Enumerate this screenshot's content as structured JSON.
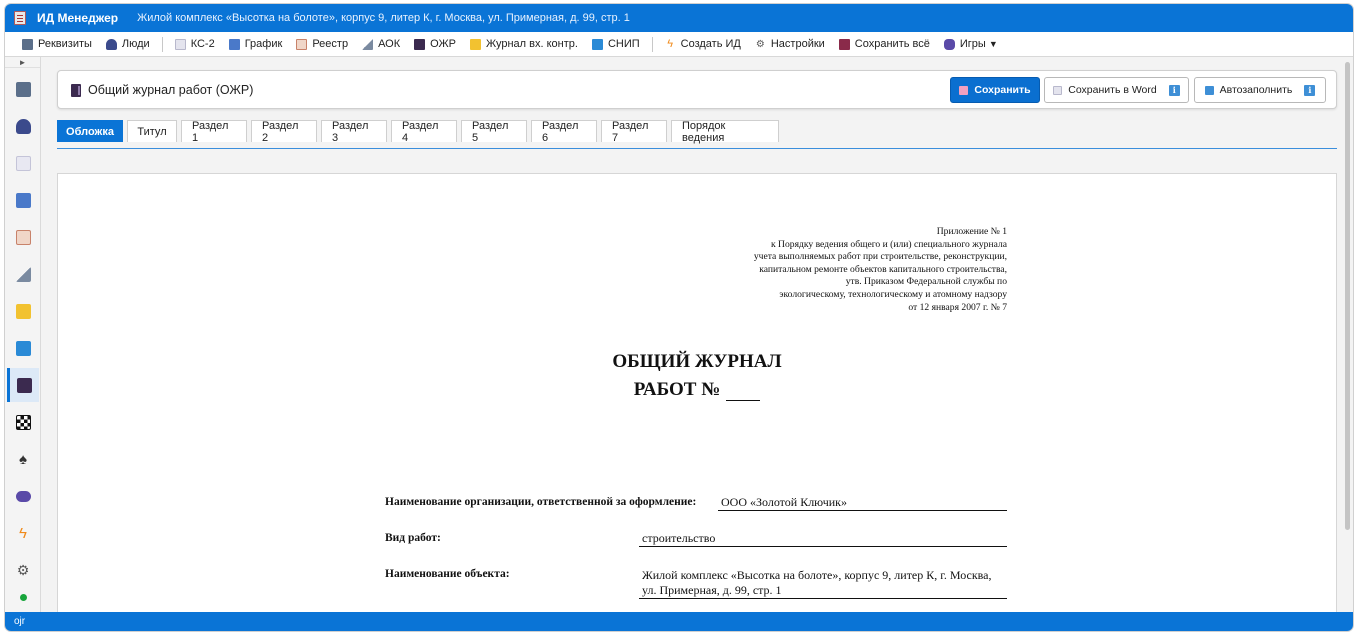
{
  "window": {
    "app_name": "ИД Менеджер",
    "project": "Жилой комплекс «Высотка на болоте», корпус 9, литер К, г. Москва, ул. Примерная, д. 99, стр. 1"
  },
  "toolbar": {
    "items": [
      {
        "label": "Реквизиты",
        "icon": "building-icon",
        "color": "#5b6f8a"
      },
      {
        "label": "Люди",
        "icon": "people-icon",
        "color": "#3b4a8c"
      },
      {
        "label": "КС-2",
        "icon": "document-icon",
        "color": "#c8c8dc"
      },
      {
        "label": "График",
        "icon": "calendar-icon",
        "color": "#4a79c9"
      },
      {
        "label": "Реестр",
        "icon": "clipboard-icon",
        "color": "#d99a7a"
      },
      {
        "label": "АОК",
        "icon": "ruler-triangle-icon",
        "color": "#7a8aa0"
      },
      {
        "label": "ОЖР",
        "icon": "book-icon",
        "color": "#3b2a4f"
      },
      {
        "label": "Журнал вх. контр.",
        "icon": "notepad-icon",
        "color": "#f2c230"
      },
      {
        "label": "СНИП",
        "icon": "blue-book-icon",
        "color": "#2a8ad6"
      },
      {
        "label": "Создать ИД",
        "icon": "lightning-icon",
        "color": "#f08a1a"
      },
      {
        "label": "Настройки",
        "icon": "gear-icon",
        "color": "#666666"
      },
      {
        "label": "Сохранить всё",
        "icon": "floppy-icon",
        "color": "#8a2a4a"
      },
      {
        "label": "Игры",
        "icon": "gamepad-icon",
        "color": "#5a4aa8",
        "caret": "▼"
      }
    ]
  },
  "sidebar": {
    "toggle": "►",
    "items": [
      {
        "icon": "building-icon",
        "color": "#5b6f8a"
      },
      {
        "icon": "people-icon",
        "color": "#3b4a8c"
      },
      {
        "icon": "document-icon",
        "color": "#d6d6e6"
      },
      {
        "icon": "calendar-icon",
        "color": "#4a79c9"
      },
      {
        "icon": "clipboard-icon",
        "color": "#d99a7a"
      },
      {
        "icon": "ruler-triangle-icon",
        "color": "#7a8aa0"
      },
      {
        "icon": "notepad-icon",
        "color": "#f2c230"
      },
      {
        "icon": "blue-book-icon",
        "color": "#2a8ad6"
      },
      {
        "icon": "book-icon",
        "color": "#3b2a4f",
        "active": true
      },
      {
        "icon": "checkerboard-icon",
        "color": "#111111"
      },
      {
        "icon": "spade-icon",
        "color": "#333333"
      },
      {
        "icon": "gamepad-icon",
        "color": "#5a4aa8"
      },
      {
        "icon": "lightning-icon",
        "color": "#f08a1a"
      },
      {
        "icon": "gear-icon",
        "color": "#555555"
      }
    ]
  },
  "panel": {
    "title": "Общий журнал работ (ОЖР)",
    "save_label": "Сохранить",
    "save_word_label": "Сохранить в Word",
    "autofill_label": "Автозаполнить",
    "info_glyph": "i"
  },
  "tabs": [
    {
      "label": "Обложка",
      "active": true
    },
    {
      "label": "Титул"
    },
    {
      "label": "Раздел 1"
    },
    {
      "label": "Раздел 2"
    },
    {
      "label": "Раздел 3"
    },
    {
      "label": "Раздел 4"
    },
    {
      "label": "Раздел 5"
    },
    {
      "label": "Раздел 6"
    },
    {
      "label": "Раздел 7"
    },
    {
      "label": "Порядок ведения"
    }
  ],
  "document": {
    "appendix": [
      "Приложение № 1",
      "к Порядку ведения общего и (или) специального журнала",
      "учета выполняемых работ при строительстве, реконструкции,",
      "капитальном ремонте объектов капитального строительства,",
      "утв. Приказом Федеральной службы по",
      "экологическому, технологическому и атомному надзору",
      "от 12 января 2007 г. № 7"
    ],
    "title_line1": "ОБЩИЙ ЖУРНАЛ",
    "title_line2": "РАБОТ №",
    "fields": {
      "org_label": "Наименование организации, ответственной за оформление:",
      "org_value": "ООО «Золотой Ключик»",
      "work_label": "Вид работ:",
      "work_value": "строительство",
      "object_label": "Наименование объекта:",
      "object_value_line1": "Жилой комплекс «Высотка на болоте», корпус 9, литер К, г. Москва,",
      "object_value_line2": "ул. Примерная, д. 99, стр. 1"
    }
  },
  "status": {
    "text": "ojr"
  },
  "colors": {
    "accent": "#0a74d6",
    "status_dot": "#18a53b"
  }
}
